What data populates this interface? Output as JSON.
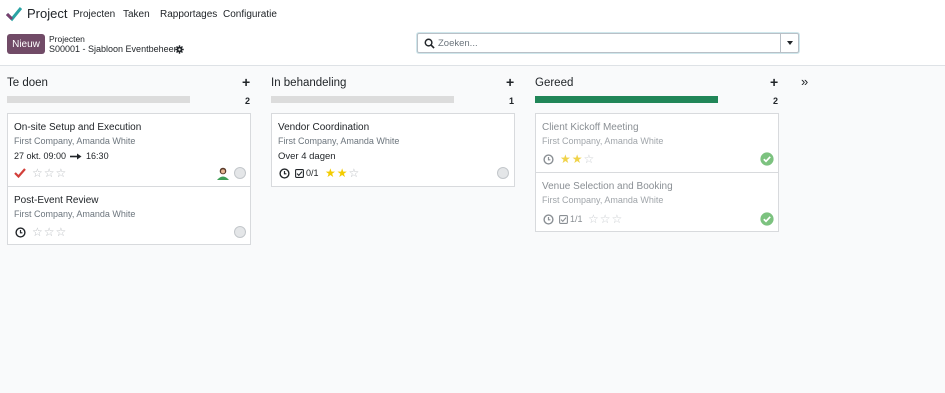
{
  "nav": {
    "app_name": "Project",
    "menu": [
      "Projecten",
      "Taken",
      "Rapportages",
      "Configuratie"
    ]
  },
  "control": {
    "new_label": "Nieuw",
    "breadcrumb_parent": "Projecten",
    "breadcrumb_current": "S00001 - Sjabloon Eventbeheer",
    "search_placeholder": "Zoeken..."
  },
  "columns": [
    {
      "title": "Te doen",
      "count": "2",
      "progress": 0,
      "cards": [
        {
          "title": "On-site Setup and Execution",
          "subtitle": "First Company, Amanda White",
          "date_start": "27 okt. 09:00",
          "date_end": "16:30",
          "stars": 0,
          "status": "check-icon",
          "avatar": true
        },
        {
          "title": "Post-Event Review",
          "subtitle": "First Company, Amanda White",
          "stars": 0,
          "status": "clock-icon"
        }
      ]
    },
    {
      "title": "In behandeling",
      "count": "1",
      "progress": 0,
      "cards": [
        {
          "title": "Vendor Coordination",
          "subtitle": "First Company, Amanda White",
          "deadline": "Over 4 dagen",
          "subtasks": "0/1",
          "stars": 2,
          "status": "clock-icon"
        }
      ]
    },
    {
      "title": "Gereed",
      "count": "2",
      "progress": 1,
      "cards": [
        {
          "title": "Client Kickoff Meeting",
          "subtitle": "First Company, Amanda White",
          "stars": 2,
          "status": "clock-icon"
        },
        {
          "title": "Venue Selection and Booking",
          "subtitle": "First Company, Amanda White",
          "subtasks": "1/1",
          "stars": 0,
          "status": "clock-icon"
        }
      ]
    }
  ],
  "colors": {
    "accent": "#714b67",
    "done_bar": "#218658",
    "star_on": "#f3cc00",
    "done_state": "#7cc27f"
  }
}
